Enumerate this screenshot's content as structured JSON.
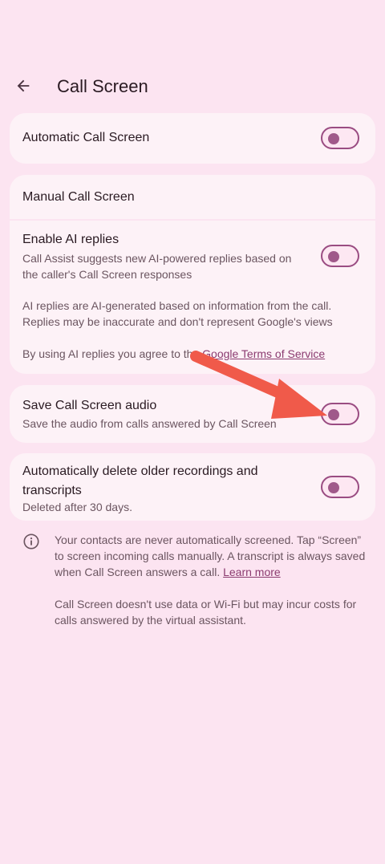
{
  "header": {
    "title": "Call Screen",
    "back_icon": "arrow-back-icon"
  },
  "auto_call_screen": {
    "label": "Automatic Call Screen",
    "enabled": false
  },
  "manual_call_screen": {
    "label": "Manual Call Screen"
  },
  "ai_replies": {
    "label": "Enable AI replies",
    "description_1": "Call Assist suggests new AI-powered replies based on",
    "description_2": "the caller's Call Screen responses",
    "notice_1": "AI replies are AI-generated based on information from the call.",
    "notice_2": "Replies may be inaccurate and don't represent Google's views",
    "terms_prefix": "By using AI replies you agree to the ",
    "terms_link": "Google Terms of Service",
    "enabled": false
  },
  "save_audio": {
    "label": "Save Call Screen audio",
    "description": "Save the audio from calls answered by Call Screen",
    "enabled": false
  },
  "auto_delete": {
    "label_1": "Automatically delete older recordings and",
    "label_2": "transcripts",
    "description": "Deleted after 30 days.",
    "enabled": false
  },
  "info": {
    "icon": "info-icon",
    "p1_line1": "Your contacts are never automatically screened. Tap “Screen”",
    "p1_line2": "to screen incoming calls manually. A transcript is always saved",
    "p1_line3_prefix": "when Call Screen answers a call. ",
    "p1_link": "Learn more",
    "p2_line1": "Call Screen doesn't use data or Wi-Fi but may incur costs for",
    "p2_line2": "calls answered by the virtual assistant."
  },
  "colors": {
    "background": "#fce4f1",
    "card": "#fdf2f7",
    "accent": "#9a4c82",
    "annotation_arrow": "#f05a4a"
  }
}
